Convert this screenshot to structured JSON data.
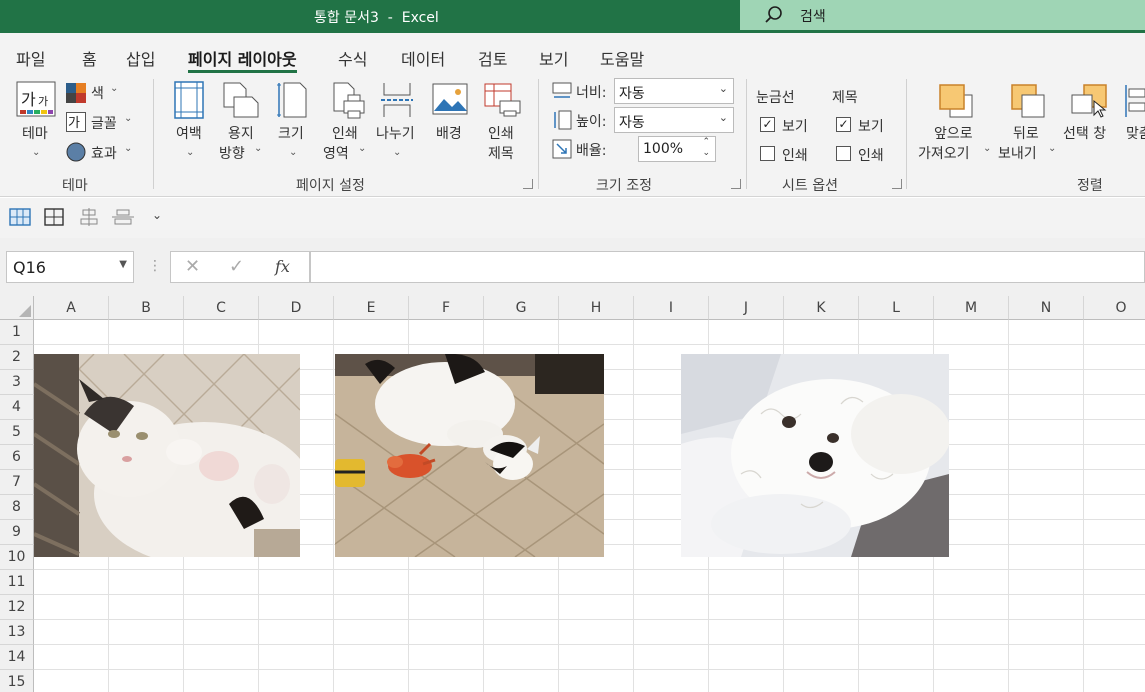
{
  "titlebar": {
    "title": "통합 문서3  -  Excel",
    "search_label": "검색"
  },
  "tabs": [
    {
      "label": "파일"
    },
    {
      "label": "홈"
    },
    {
      "label": "삽입"
    },
    {
      "label": "페이지 레이아웃"
    },
    {
      "label": "수식"
    },
    {
      "label": "데이터"
    },
    {
      "label": "검토"
    },
    {
      "label": "보기"
    },
    {
      "label": "도움말"
    }
  ],
  "ribbon": {
    "theme": {
      "themes": "테마",
      "colors": "색",
      "fonts": "글꼴",
      "effects": "효과",
      "group": "테마"
    },
    "page_setup": {
      "margins": "여백",
      "orientation": [
        "용지",
        "방향"
      ],
      "size": "크기",
      "print_area": [
        "인쇄",
        "영역"
      ],
      "breaks": "나누기",
      "background": "배경",
      "print_titles": [
        "인쇄",
        "제목"
      ],
      "group": "페이지 설정"
    },
    "scale": {
      "width_label": "너비:",
      "width_value": "자동",
      "height_label": "높이:",
      "height_value": "자동",
      "scale_label": "배율:",
      "scale_value": "100%",
      "group": "크기 조정"
    },
    "sheet_options": {
      "gridlines": "눈금선",
      "headings": "제목",
      "view": "보기",
      "print": "인쇄",
      "group": "시트 옵션"
    },
    "arrange": {
      "bring_forward": [
        "앞으로",
        "가져오기"
      ],
      "send_backward": [
        "뒤로",
        "보내기"
      ],
      "selection_pane": "선택 창",
      "align": "맞춤",
      "group": "정렬"
    }
  },
  "formula": {
    "name_box": "Q16",
    "fx": "fx",
    "content": ""
  },
  "sheet": {
    "columns": [
      "A",
      "B",
      "C",
      "D",
      "E",
      "F",
      "G",
      "H",
      "I",
      "J",
      "K",
      "L",
      "M",
      "N",
      "O"
    ],
    "rows": [
      "1",
      "2",
      "3",
      "4",
      "5",
      "6",
      "7",
      "8",
      "9",
      "10",
      "11",
      "12",
      "13",
      "14",
      "15"
    ]
  },
  "colors": {
    "accent": "#217346",
    "search": "#9fd5b5",
    "ribbon_bg": "#f3f3f3"
  }
}
